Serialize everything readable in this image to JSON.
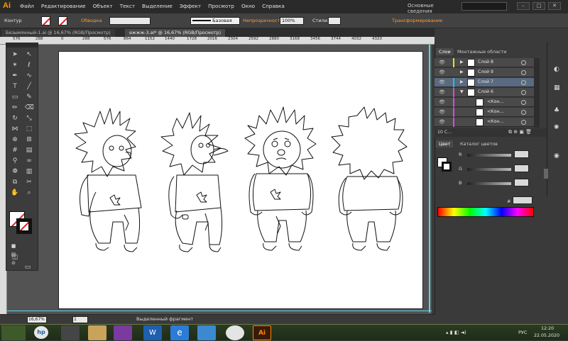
{
  "app": {
    "logo": "Ai",
    "menu": [
      "Файл",
      "Редактирование",
      "Объект",
      "Текст",
      "Выделение",
      "Эффект",
      "Просмотр",
      "Окно",
      "Справка"
    ],
    "workspace": "Основные сведения"
  },
  "control_bar": {
    "mode_label": "Контур",
    "stroke_label": "Обводка",
    "stroke_style": "Базовая",
    "opacity_label": "Непрозрачность:",
    "opacity_value": "100%",
    "styles_label": "Стили:",
    "transform_label": "Трансформирование"
  },
  "doc_tabs": [
    {
      "label": "Безымянный-1.ai @ 16,67% (RGB/Просмотр)",
      "active": false
    },
    {
      "label": "ежжж-3.ai* @ 16,67% (RGB/Просмотр)",
      "active": true
    }
  ],
  "ruler_ticks": [
    "576",
    "288",
    "0",
    "288",
    "576",
    "864",
    "1152",
    "1440",
    "1728",
    "2016",
    "2304",
    "2592",
    "2880",
    "3168",
    "3456",
    "3744",
    "4032",
    "4320"
  ],
  "status": {
    "zoom": "16,67%",
    "page": "1",
    "message": "Выделенный фрагмент"
  },
  "layers_panel": {
    "tabs": [
      "Слои",
      "Монтажные области"
    ],
    "rows": [
      {
        "name": "Слой 8",
        "color": "#e8e01a",
        "expanded": false
      },
      {
        "name": "Слой 9",
        "color": "#2b2b2b",
        "expanded": false
      },
      {
        "name": "Слой 7",
        "color": "#19c4d6",
        "expanded": false
      },
      {
        "name": "Слой 6",
        "color": "#d94bd9",
        "expanded": true
      },
      {
        "name": "<Кон...",
        "color": "#d94bd9",
        "expanded": false
      },
      {
        "name": "<Кон...",
        "color": "#d94bd9",
        "expanded": false
      },
      {
        "name": "<Кон...",
        "color": "#d94bd9",
        "expanded": false
      }
    ],
    "footer": "10 С..."
  },
  "color_panel": {
    "tabs": [
      "Цвет",
      "Каталог цветов"
    ],
    "channels": [
      "R",
      "G",
      "B"
    ],
    "hex_label": "#"
  },
  "taskbar": {
    "lang": "РУС",
    "time": "12:20",
    "date": "22.05.2020"
  }
}
